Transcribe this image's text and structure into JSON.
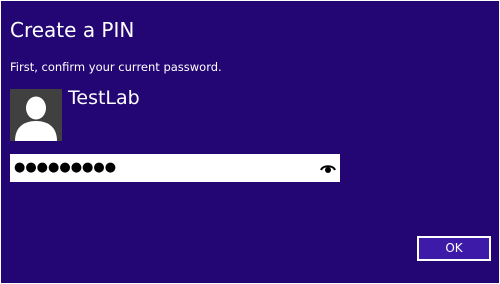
{
  "dialog": {
    "title": "Create a PIN",
    "instruction": "First, confirm your current password.",
    "user": {
      "name": "TestLab"
    },
    "password_field": {
      "masked_value": "●●●●●●●●●",
      "reveal_icon": "eye-icon"
    },
    "ok_label": "OK"
  },
  "colors": {
    "background": "#230674",
    "button_fill": "#3d1ba8",
    "avatar_bg": "#404040",
    "text": "#ffffff"
  }
}
